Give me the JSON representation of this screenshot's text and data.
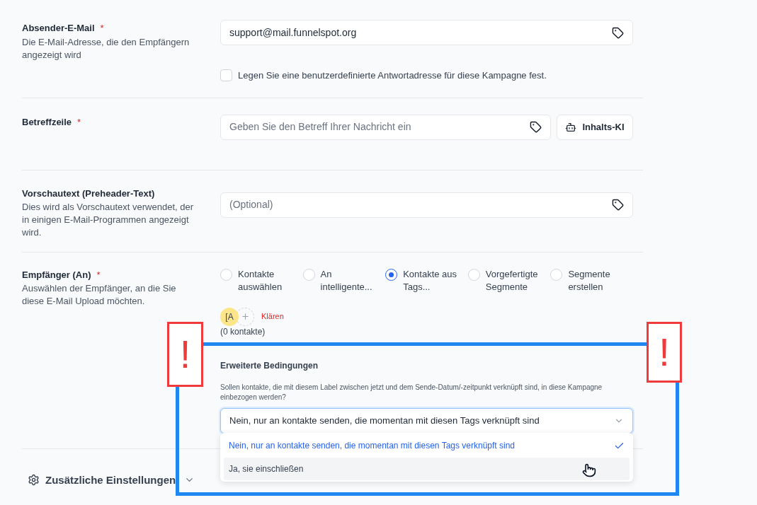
{
  "sender": {
    "label": "Absender-E-Mail",
    "required_mark": "*",
    "description": "Die E-Mail-Adresse, die den Empfängern angezeigt wird",
    "value": "support@mail.funnelspot.org"
  },
  "reply_checkbox": {
    "label": "Legen Sie eine benutzerdefinierte Antwortadresse für diese Kampagne fest.",
    "checked": false
  },
  "subject": {
    "label": "Betreffzeile",
    "required_mark": "*",
    "placeholder": "Geben Sie den Betreff Ihrer Nachricht ein",
    "ai_button": "Inhalts-KI"
  },
  "preview": {
    "label": "Vorschautext (Preheader-Text)",
    "description": "Dies wird als Vorschautext verwendet, der in einigen E-Mail-Programmen angezeigt wird.",
    "placeholder": "(Optional)"
  },
  "recipients": {
    "label": "Empfänger (An)",
    "required_mark": "*",
    "description": "Auswählen der Empfänger, an die Sie diese E-Mail Upload möchten.",
    "options": [
      {
        "label": "Kontakte auswählen",
        "selected": false
      },
      {
        "label": "An intelligente...",
        "selected": false
      },
      {
        "label": "Kontakte aus Tags...",
        "selected": true
      },
      {
        "label": "Vorgefertigte Segmente",
        "selected": false
      },
      {
        "label": "Segmente erstellen",
        "selected": false
      }
    ],
    "tag_chip": "[A",
    "clear": "Klären",
    "count": "(0 kontakte)"
  },
  "advanced": {
    "title": "Erweiterte Bedingungen",
    "question": "Sollen kontakte, die mit diesem Label zwischen jetzt und dem Sende-Datum/-zeitpunkt verknüpft sind, in diese Kampagne einbezogen werden?",
    "select_value": "Nein, nur an kontakte senden, die momentan mit diesen Tags verknüpft sind",
    "dropdown": [
      {
        "label": "Nein, nur an kontakte senden, die momentan mit diesen Tags verknüpft sind",
        "selected": true,
        "highlighted": false
      },
      {
        "label": "Ja, sie einschließen",
        "selected": false,
        "highlighted": true
      }
    ]
  },
  "additional": {
    "label": "Zusätzliche Einstellungen"
  },
  "annotations": [
    "!",
    "!"
  ]
}
